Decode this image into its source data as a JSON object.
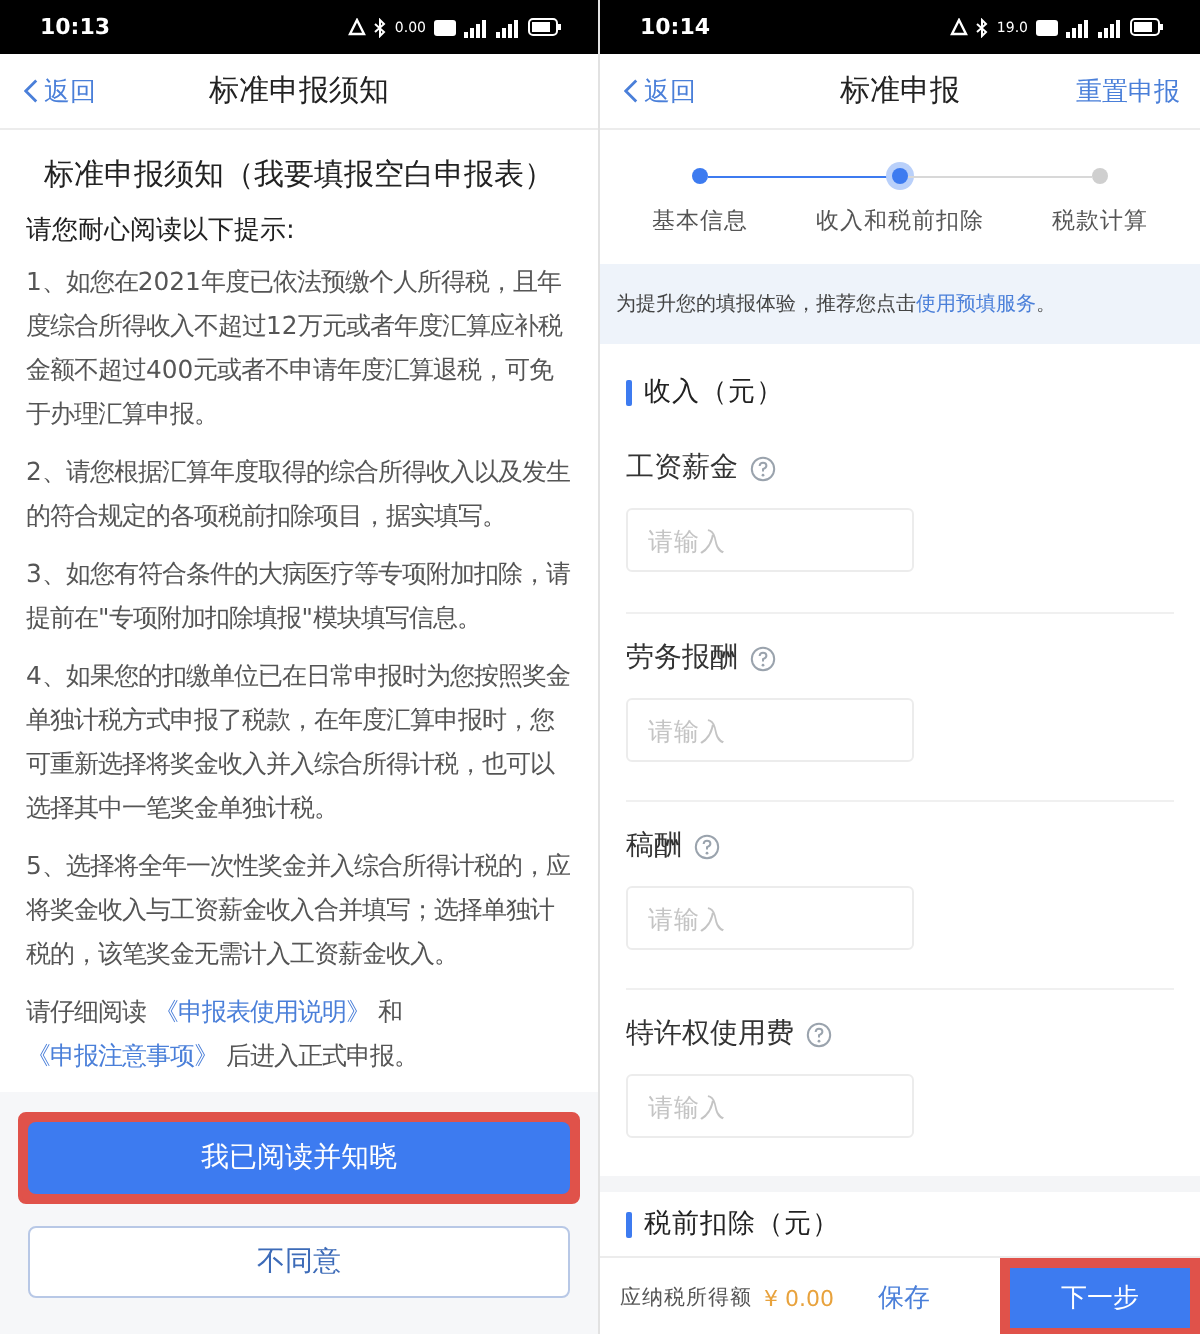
{
  "notice_screen": {
    "status_bar": {
      "time": "10:13",
      "speed": "0.00"
    },
    "nav": {
      "back": "返回",
      "title": "标准申报须知"
    },
    "heading": "标准申报须知（我要填报空白申报表）",
    "intro": "请您耐心阅读以下提示:",
    "paragraphs": [
      "1、如您在2021年度已依法预缴个人所得税，且年度综合所得收入不超过12万元或者年度汇算应补税金额不超过400元或者不申请年度汇算退税，可免于办理汇算申报。",
      "2、请您根据汇算年度取得的综合所得收入以及发生的符合规定的各项税前扣除项目，据实填写。",
      "3、如您有符合条件的大病医疗等专项附加扣除，请提前在\"专项附加扣除填报\"模块填写信息。",
      "4、如果您的扣缴单位已在日常申报时为您按照奖金单独计税方式申报了税款，在年度汇算申报时，您可重新选择将奖金收入并入综合所得计税，也可以选择其中一笔奖金单独计税。",
      "5、选择将全年一次性奖金并入综合所得计税的，应将奖金收入与工资薪金收入合并填写；选择单独计税的，该笔奖金无需计入工资薪金收入。"
    ],
    "closing": {
      "before": "请仔细阅读",
      "link1": "《申报表使用说明》",
      "middle": "和",
      "link2": "《申报注意事项》",
      "after": "后进入正式申报。"
    },
    "buttons": [
      {
        "label": "我已阅读并知晓",
        "kind": "primary",
        "highlighted": true
      },
      {
        "label": "不同意",
        "kind": "outline",
        "highlighted": false
      }
    ]
  },
  "form_screen": {
    "status_bar": {
      "time": "10:14",
      "speed": "19.0"
    },
    "nav": {
      "back": "返回",
      "title": "标准申报",
      "action": "重置申报"
    },
    "steps": [
      {
        "label": "基本信息",
        "done": true,
        "selected": false
      },
      {
        "label": "收入和税前扣除",
        "done": false,
        "selected": true
      },
      {
        "label": "税款计算",
        "done": false,
        "selected": false
      }
    ],
    "tip": {
      "text": "为提升您的填报体验，推荐您点击",
      "link": "使用预填服务",
      "end": "。"
    },
    "income_section": "收入（元）",
    "fields": [
      {
        "label": "工资薪金",
        "placeholder": "请输入"
      },
      {
        "label": "劳务报酬",
        "placeholder": "请输入"
      },
      {
        "label": "稿酬",
        "placeholder": "请输入"
      },
      {
        "label": "特许权使用费",
        "placeholder": "请输入"
      }
    ],
    "deduction_section": "税前扣除（元）",
    "bottom_bar": {
      "label": "应纳税所得额",
      "amount": "¥ 0.00",
      "save": "保存",
      "next": "下一步",
      "next_highlighted": true
    }
  }
}
